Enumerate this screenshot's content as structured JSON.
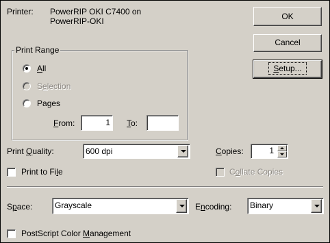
{
  "printer": {
    "label_pre": "Printer:",
    "name_line1": "PowerRIP OKI C7400 on",
    "name_line2": "PowerRIP-OKI"
  },
  "buttons": {
    "ok": "OK",
    "cancel": "Cancel",
    "setup_hot": "S",
    "setup_rest": "etup..."
  },
  "print_range": {
    "title": "Print Range",
    "all_hot": "A",
    "all_rest": "ll",
    "selection_pre": "S",
    "selection_hot": "e",
    "selection_rest": "lection",
    "pages_pre": "Pa",
    "pages_hot": "g",
    "pages_rest": "es",
    "from_hot": "F",
    "from_rest": "rom:",
    "from_value": "1",
    "to_hot": "T",
    "to_rest": "o:",
    "to_value": "",
    "selected": "All"
  },
  "quality": {
    "label_pre": "Print ",
    "label_hot": "Q",
    "label_rest": "uality:",
    "value": "600 dpi"
  },
  "copies": {
    "label_hot": "C",
    "label_rest": "opies:",
    "value": "1"
  },
  "print_to_file": {
    "label_pre": "Print to Fi",
    "label_hot": "l",
    "label_rest": "e",
    "checked": false
  },
  "collate": {
    "label_pre": "C",
    "label_hot": "o",
    "label_rest": "llate Copies",
    "checked": false,
    "enabled": false
  },
  "space": {
    "label_pre": "S",
    "label_hot": "p",
    "label_rest": "ace:",
    "value": "Grayscale"
  },
  "encoding": {
    "label_pre": "E",
    "label_hot": "n",
    "label_rest": "coding:",
    "value": "Binary"
  },
  "color_mgmt": {
    "label_pre": "PostScript Color ",
    "label_hot": "M",
    "label_rest": "anagement",
    "checked": false
  }
}
